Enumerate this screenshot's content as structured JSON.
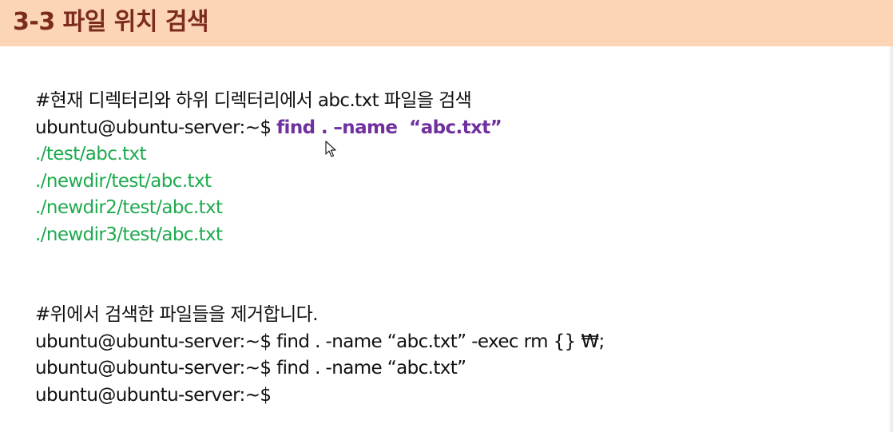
{
  "title": "3-3 파일 위치 검색",
  "block1": {
    "comment": "#현재 디렉터리와 하위 디렉터리에서 abc.txt 파일을 검색",
    "prompt": "ubuntu@ubuntu-server:~$ ",
    "command": "find . –name  “abc.txt”",
    "results": [
      "./test/abc.txt",
      "./newdir/test/abc.txt",
      "./newdir2/test/abc.txt",
      "./newdir3/test/abc.txt"
    ]
  },
  "block2": {
    "comment": "#위에서 검색한 파일들을 제거합니다.",
    "lines": [
      "ubuntu@ubuntu-server:~$ find . -name “abc.txt” -exec rm {} ₩;",
      "ubuntu@ubuntu-server:~$ find . -name “abc.txt”",
      "ubuntu@ubuntu-server:~$"
    ]
  },
  "colors": {
    "title_bar": "#fbd5b5",
    "title_text": "#7b2a1e",
    "command": "#7030a0",
    "output": "#1faa4f"
  },
  "icons": {
    "cursor": "mouse-pointer-icon"
  }
}
